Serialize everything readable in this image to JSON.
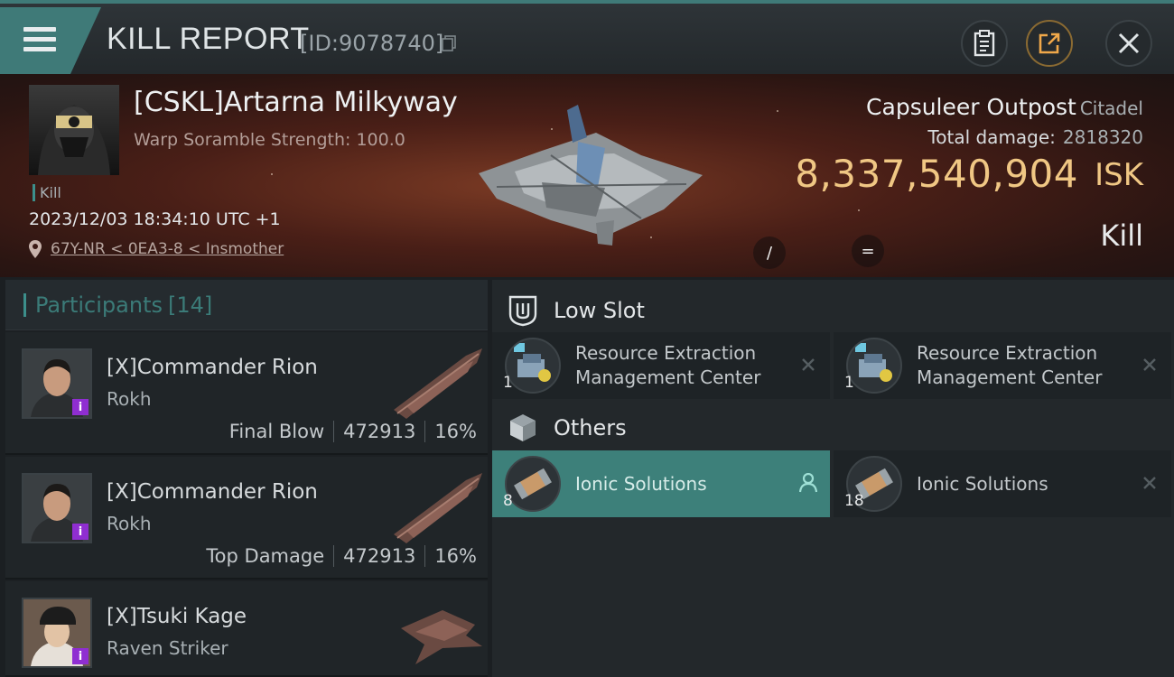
{
  "header": {
    "title": "KILL REPORT",
    "report_id": "[ID:9078740]",
    "buttons": [
      "clipboard-icon",
      "share-icon",
      "close-icon"
    ]
  },
  "victim": {
    "name": "[CSKL]Artarna Milkyway",
    "warp_scramble": "Warp Soramble Strength: 100.0",
    "tag": "Kill",
    "timestamp": "2023/12/03 18:34:10 UTC +1",
    "location": "67Y-NR < 0EA3-8 < Insmother",
    "overlay_left": "/",
    "overlay_right": "="
  },
  "target": {
    "name": "Capsuleer Outpost",
    "class": "Citadel",
    "total_damage_label": "Total damage:",
    "total_damage": "2818320",
    "isk_value": "8,337,540,904",
    "isk_unit": "ISK",
    "result": "Kill"
  },
  "participants": {
    "label": "Participants",
    "count": "[14]",
    "rows": [
      {
        "name": "[X]Commander Rion",
        "ship": "Rokh",
        "role": "Final Blow",
        "damage": "472913",
        "percent": "16%",
        "badge": "i"
      },
      {
        "name": "[X]Commander Rion",
        "ship": "Rokh",
        "role": "Top Damage",
        "damage": "472913",
        "percent": "16%",
        "badge": "i"
      },
      {
        "name": "[X]Tsuki Kage",
        "ship": "Raven Striker",
        "badge": "i"
      }
    ]
  },
  "sections": {
    "low_slot": {
      "title": "Low Slot",
      "items": [
        {
          "line1": "Resource Extraction",
          "line2": "Management Center",
          "qty": "1"
        },
        {
          "line1": "Resource Extraction",
          "line2": "Management Center",
          "qty": "1"
        }
      ]
    },
    "others": {
      "title": "Others",
      "items": [
        {
          "line1": "Ionic Solutions",
          "qty": "8"
        },
        {
          "line1": "Ionic Solutions",
          "qty": "18"
        }
      ]
    }
  },
  "colors": {
    "accent": "#3c8f8b",
    "isk": "#f0c784",
    "badge": "#8f2ed1"
  }
}
